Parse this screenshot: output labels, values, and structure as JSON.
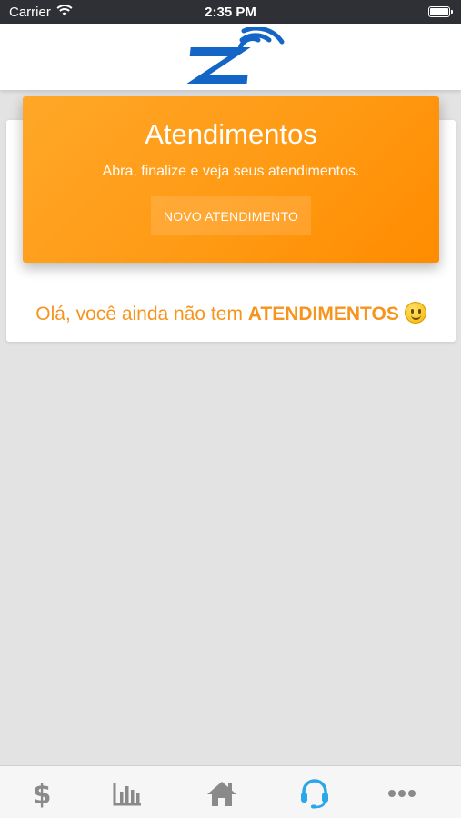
{
  "status_bar": {
    "carrier": "Carrier",
    "time": "2:35 PM"
  },
  "header": {
    "logo": "z-wifi-logo"
  },
  "hero": {
    "title": "Atendimentos",
    "subtitle": "Abra, finalize e veja seus atendimentos.",
    "button_label": "NOVO ATENDIMENTO"
  },
  "empty_state": {
    "prefix": "Olá, você ainda não tem ",
    "highlight": "ATENDIMENTOS",
    "emoji": "slightly-smiling-face"
  },
  "tabs": [
    {
      "icon": "dollar-icon",
      "active": false
    },
    {
      "icon": "bar-chart-icon",
      "active": false
    },
    {
      "icon": "home-icon",
      "active": false
    },
    {
      "icon": "headset-icon",
      "active": true
    },
    {
      "icon": "more-icon",
      "active": false
    }
  ],
  "colors": {
    "accent": "#ff9a14",
    "text_accent": "#f7941d",
    "active_tab": "#2aa7e8",
    "inactive_tab": "#8a8a8a",
    "logo_blue": "#1466c6"
  }
}
